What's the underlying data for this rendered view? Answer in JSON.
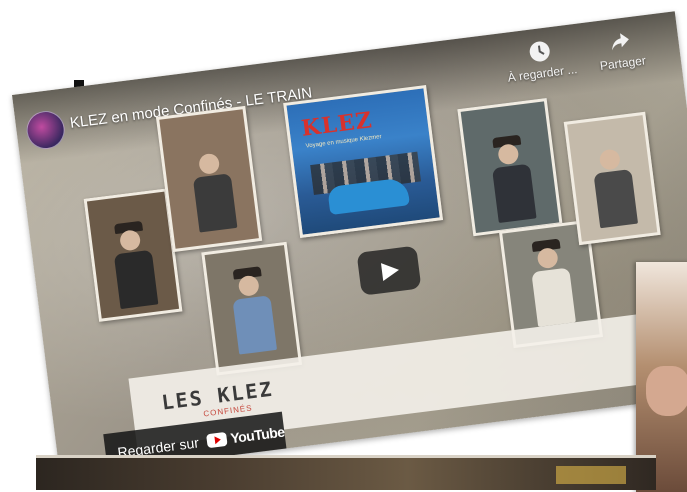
{
  "video": {
    "title": "KLEZ en mode Confinés - LE TRAIN",
    "channel_avatar": "klez-channel-avatar"
  },
  "controls": {
    "watch_later_label": "À regarder ...",
    "share_label": "Partager",
    "watch_later_icon": "clock-icon",
    "share_icon": "share-arrow-icon"
  },
  "album": {
    "title": "KLEZ",
    "subtitle": "Voyage en musique Klezmer"
  },
  "overlay": {
    "logo_text": "LES KLEZ",
    "logo_sub": "CONFINÉS",
    "watch_on_label": "Regarder sur",
    "youtube_word": "YouTube"
  },
  "colors": {
    "youtube_red": "#dd0000",
    "overlay_dark": "#141414",
    "album_blue": "#2d6fb8",
    "album_title_red": "#d8322c"
  }
}
